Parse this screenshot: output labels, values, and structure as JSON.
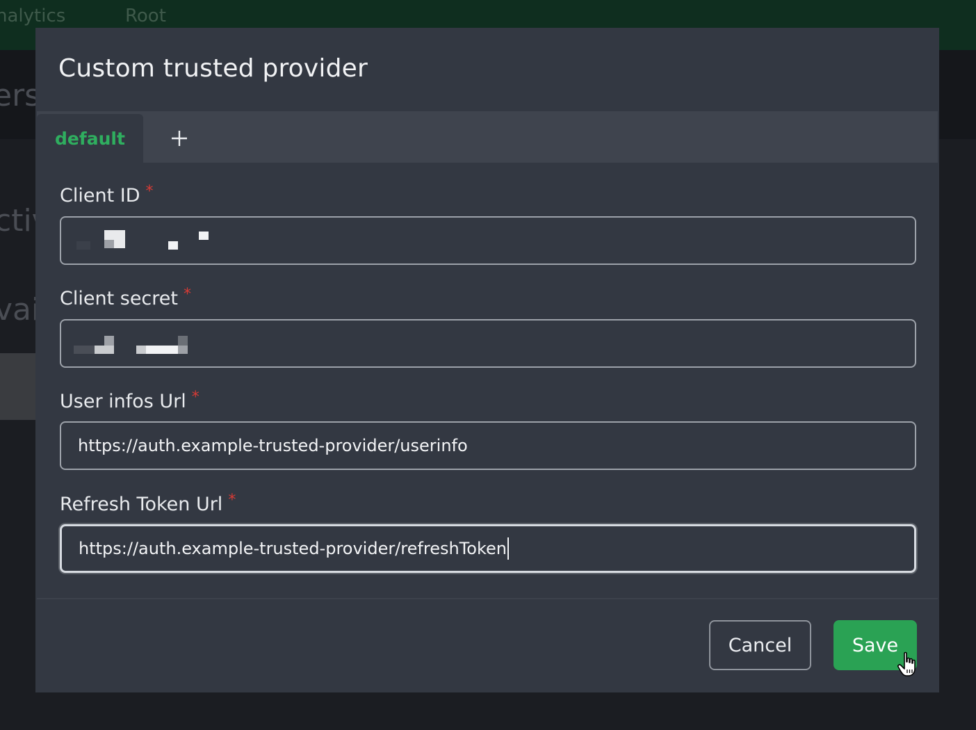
{
  "background": {
    "nav": [
      "nalytics",
      "Root"
    ],
    "heading_fragment": "ers",
    "line_fragments": [
      "ctiv",
      "vail"
    ]
  },
  "modal": {
    "title": "Custom trusted provider",
    "tabs": [
      {
        "label": "default",
        "active": true
      },
      {
        "label": "+",
        "icon": "plus-icon"
      }
    ],
    "fields": {
      "client_id": {
        "label": "Client ID",
        "required_marker": "*",
        "value": ""
      },
      "client_secret": {
        "label": "Client secret",
        "required_marker": "*",
        "value": ""
      },
      "user_infos_url": {
        "label": "User infos Url",
        "required_marker": "*",
        "value": "https://auth.example-trusted-provider/userinfo"
      },
      "refresh_token_url": {
        "label": "Refresh Token Url",
        "required_marker": "*",
        "value": "https://auth.example-trusted-provider/refreshToken"
      }
    },
    "buttons": {
      "cancel": "Cancel",
      "save": "Save"
    }
  },
  "colors": {
    "accent_green": "#2aa254",
    "tab_active_text": "#2fae5f",
    "required_red": "#d83b35",
    "modal_bg": "#333842"
  }
}
